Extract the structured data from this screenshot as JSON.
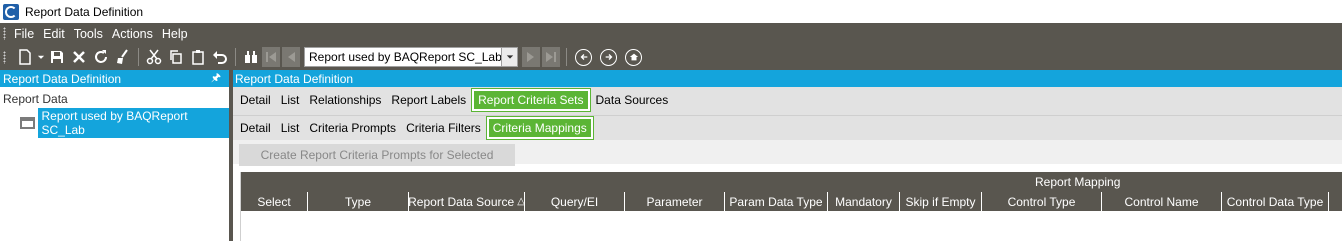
{
  "window": {
    "title": "Report Data Definition"
  },
  "menu": {
    "items": [
      "File",
      "Edit",
      "Tools",
      "Actions",
      "Help"
    ]
  },
  "toolbar": {
    "navigator_value": "Report used by BAQReport SC_Lab"
  },
  "left_panel": {
    "header": "Report Data Definition",
    "tree_root": "Report Data",
    "tree_node": "Report used by BAQReport SC_Lab"
  },
  "right_panel": {
    "header": "Report Data Definition",
    "tabs_primary": [
      "Detail",
      "List",
      "Relationships",
      "Report Labels",
      "Report Criteria Sets",
      "Data Sources"
    ],
    "active_primary": "Report Criteria Sets",
    "tabs_secondary": [
      "Detail",
      "List",
      "Criteria Prompts",
      "Criteria Filters",
      "Criteria Mappings"
    ],
    "active_secondary": "Criteria Mappings",
    "create_button": "Create Report Criteria Prompts for Selected",
    "grid_group": "Report Mapping",
    "columns": [
      "Select",
      "Type",
      "Report Data Source",
      "Query/EI",
      "Parameter",
      "Param Data Type",
      "Mandatory",
      "Skip if Empty",
      "Control Type",
      "Control Name",
      "Control Data Type"
    ],
    "sort_column": "Report Data Source"
  },
  "colors": {
    "accent": "#14a4dc",
    "active_tab": "#5bb535",
    "chrome": "#59564f"
  }
}
